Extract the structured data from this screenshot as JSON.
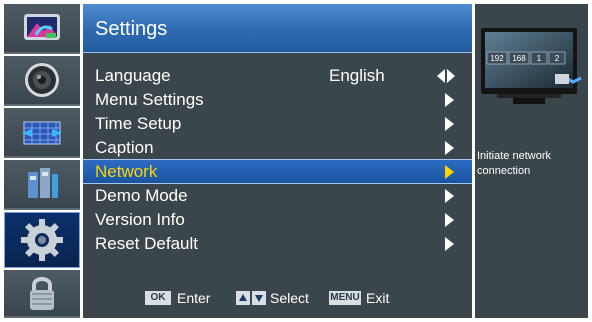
{
  "categories": [
    {
      "id": "picture",
      "icon": "picture-icon",
      "active": false
    },
    {
      "id": "audio",
      "icon": "speaker-icon",
      "active": false
    },
    {
      "id": "channel",
      "icon": "satellite-dish-icon",
      "active": false
    },
    {
      "id": "input",
      "icon": "source-icon",
      "active": false
    },
    {
      "id": "settings",
      "icon": "gear-icon",
      "active": true
    },
    {
      "id": "lock",
      "icon": "padlock-icon",
      "active": false
    }
  ],
  "menu": {
    "title": "Settings",
    "items": [
      {
        "label": "Language",
        "value": "English",
        "indicator": "left-right"
      },
      {
        "label": "Menu Settings",
        "value": "",
        "indicator": "right"
      },
      {
        "label": "Time Setup",
        "value": "",
        "indicator": "right"
      },
      {
        "label": "Caption",
        "value": "",
        "indicator": "right"
      },
      {
        "label": "Network",
        "value": "",
        "indicator": "right",
        "selected": true
      },
      {
        "label": "Demo Mode",
        "value": "",
        "indicator": "right"
      },
      {
        "label": "Version Info",
        "value": "",
        "indicator": "right"
      },
      {
        "label": "Reset Default",
        "value": "",
        "indicator": "right"
      }
    ]
  },
  "footer": {
    "ok_key": "OK",
    "enter_label": "Enter",
    "select_label": "Select",
    "menu_key": "MENU",
    "exit_label": "Exit"
  },
  "help": {
    "text": "Initiate network connection",
    "ip_fields": [
      "192",
      "168",
      "1",
      "2"
    ]
  },
  "colors": {
    "panel": "#3b454c",
    "title_blue": "#2e6ab0",
    "highlight": "#1b54a0",
    "selected_text": "#ffd200"
  }
}
